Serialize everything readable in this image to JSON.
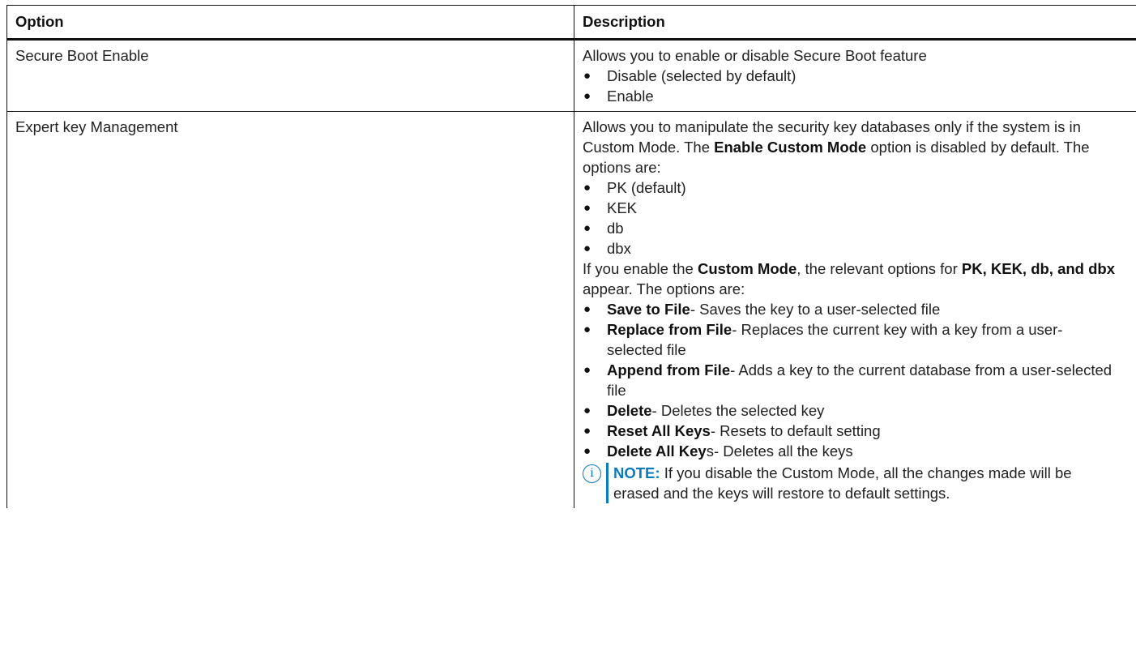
{
  "table": {
    "headers": [
      "Option",
      "Description"
    ],
    "rows": [
      {
        "option": "Secure Boot Enable",
        "intro": "Allows you to enable or disable Secure Boot feature",
        "bullets": [
          "Disable (selected by default)",
          "Enable"
        ]
      },
      {
        "option": "Expert key Management",
        "intro_1": "Allows you to manipulate the security key databases only if the system is in Custom Mode. The ",
        "intro_bold": "Enable Custom Mode",
        "intro_2": " option is disabled by default. The options are:",
        "bullets": [
          "PK (default)",
          "KEK",
          "db",
          "dbx"
        ],
        "custom_1": "If you enable the ",
        "custom_bold_1": "Custom Mode",
        "custom_2": ", the relevant options for ",
        "custom_bold_2": "PK, KEK, db, and dbx",
        "custom_3": " appear. The options are:",
        "actions": [
          {
            "bold": "Save to File",
            "text": "- Saves the key to a user-selected file"
          },
          {
            "bold": "Replace from File",
            "text": "- Replaces the current key with a key from a user-selected file"
          },
          {
            "bold": "Append from File",
            "text": "- Adds a key to the current database from a user-selected file"
          },
          {
            "bold": "Delete",
            "text": "- Deletes the selected key"
          },
          {
            "bold": "Reset All Keys",
            "text": "- Resets to default setting"
          },
          {
            "bold": "Delete All Key",
            "text": "s- Deletes all the keys"
          }
        ],
        "note_label": "NOTE:",
        "note_text": " If you disable the Custom Mode, all the changes made will be erased and the keys will restore to default settings."
      }
    ]
  },
  "bullet_glyph": "●",
  "icons": {
    "note": "info-circle-icon"
  },
  "colors": {
    "note_accent": "#0a7bbf"
  }
}
